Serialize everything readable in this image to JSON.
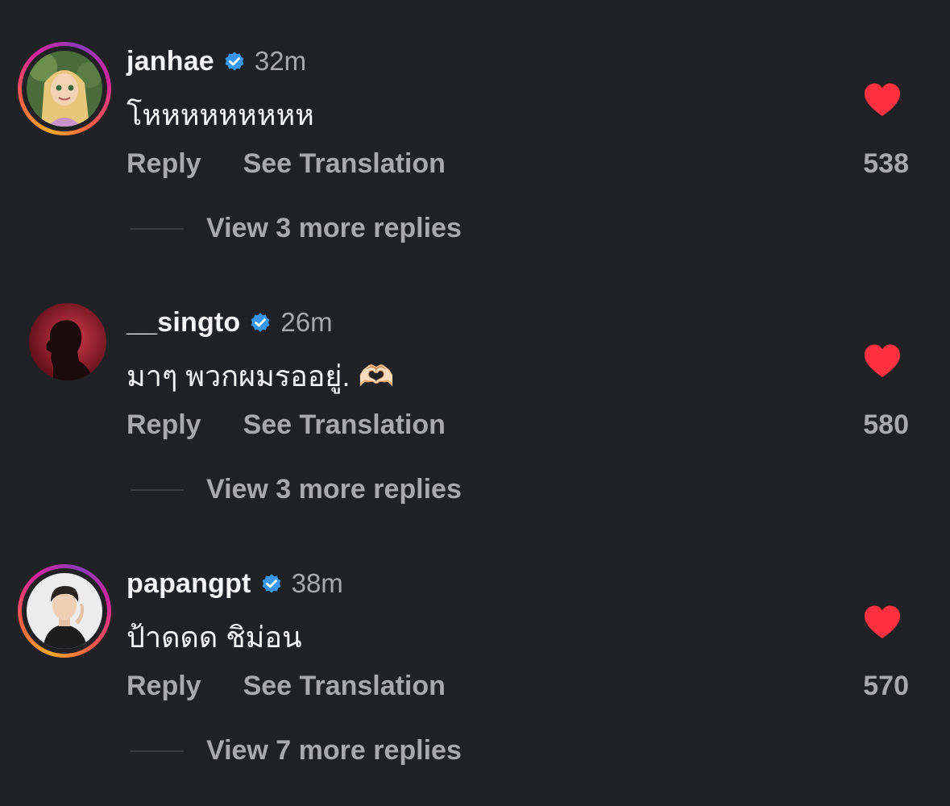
{
  "comments": [
    {
      "username": "janhae",
      "verified": true,
      "time": "32m",
      "text": "โหหหหหหหหห",
      "reply_label": "Reply",
      "translate_label": "See Translation",
      "likes": "538",
      "liked": true,
      "view_replies": "View 3 more replies",
      "story_ring": true
    },
    {
      "username": "__singto",
      "verified": true,
      "time": "26m",
      "text": "มาๆ พวกผมรออยู่. 🫶🏻",
      "reply_label": "Reply",
      "translate_label": "See Translation",
      "likes": "580",
      "liked": true,
      "view_replies": "View 3 more replies",
      "story_ring": false
    },
    {
      "username": "papangpt",
      "verified": true,
      "time": "38m",
      "text": "ป้าดดด ชิม่อน",
      "reply_label": "Reply",
      "translate_label": "See Translation",
      "likes": "570",
      "liked": true,
      "view_replies": "View 7 more replies",
      "story_ring": true
    }
  ],
  "colors": {
    "background": "#202125",
    "heart": "#ff3040",
    "verified": "#3797f0",
    "muted_text": "#a8a8ad"
  }
}
